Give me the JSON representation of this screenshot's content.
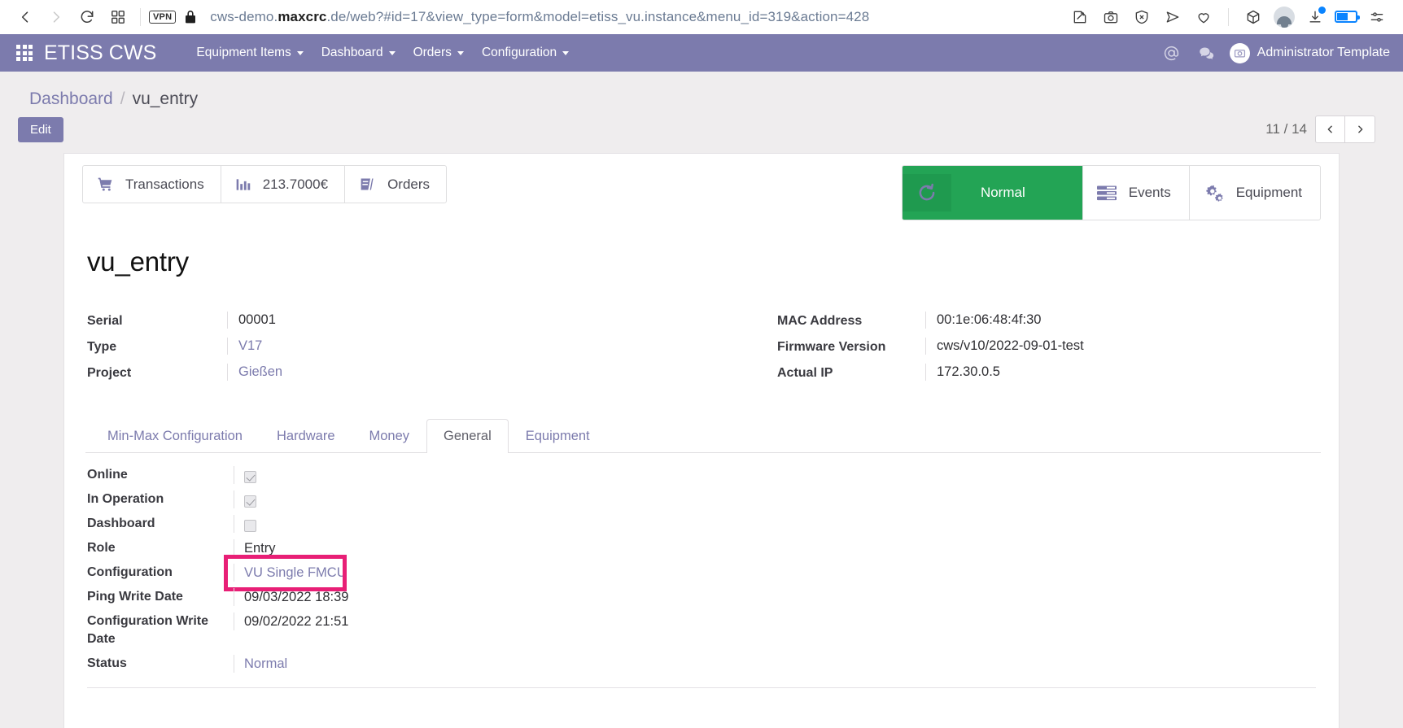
{
  "browser": {
    "back_icon": "back-arrow-icon",
    "forward_icon": "forward-arrow-icon",
    "reload_icon": "reload-icon",
    "tabs_icon": "tab-overview-icon",
    "vpn_label": "VPN",
    "lock_icon": "padlock-icon",
    "url_prefix": "cws-demo.",
    "url_domain": "maxcrc",
    "url_suffix": ".de/web?#id=17&view_type=form&model=etiss_vu.instance&menu_id=319&action=428",
    "right_icons": [
      "annotate-icon",
      "screenshot-icon",
      "shield-x-icon",
      "send-icon",
      "heart-icon",
      "extensions-cube-icon",
      "profile-avatar-icon",
      "downloads-icon",
      "battery-icon",
      "settings-sliders-icon"
    ]
  },
  "appnav": {
    "apps_icon": "apps-grid-icon",
    "brand": "ETISS CWS",
    "menus": [
      {
        "label": "Equipment Items",
        "caret": true
      },
      {
        "label": "Dashboard",
        "caret": true
      },
      {
        "label": "Orders",
        "caret": true
      },
      {
        "label": "Configuration",
        "caret": true
      }
    ],
    "mention_icon": "at-mention-icon",
    "chat_icon": "chat-bubble-icon",
    "user_name": "Administrator Template",
    "user_avatar_icon": "user-avatar-icon",
    "bar_color": "#7c7bad"
  },
  "breadcrumb": {
    "root": "Dashboard",
    "separator": "/",
    "current": "vu_entry"
  },
  "actions": {
    "edit_label": "Edit",
    "pager_label": "11 / 14",
    "prev_icon": "chevron-left-icon",
    "next_icon": "chevron-right-icon"
  },
  "stat_buttons": [
    {
      "label": "Transactions",
      "icon": "shopping-cart-icon"
    },
    {
      "label": "213.7000€",
      "icon": "bar-chart-icon"
    },
    {
      "label": "Orders",
      "icon": "book-orders-icon"
    }
  ],
  "status_buttons": [
    {
      "label": "Normal",
      "icon": "refresh-circle-icon",
      "state": "green",
      "color": "#23a455"
    },
    {
      "label": "Events",
      "icon": "list-lines-icon"
    },
    {
      "label": "Equipment",
      "icon": "gears-icon"
    }
  ],
  "record": {
    "title": "vu_entry",
    "left_fields": [
      {
        "label": "Serial",
        "value": "00001",
        "link": false
      },
      {
        "label": "Type",
        "value": "V17",
        "link": true
      },
      {
        "label": "Project",
        "value": "Gießen",
        "link": true
      }
    ],
    "right_fields": [
      {
        "label": "MAC Address",
        "value": "00:1e:06:48:4f:30",
        "link": false
      },
      {
        "label": "Firmware Version",
        "value": "cws/v10/2022-09-01-test",
        "link": false
      },
      {
        "label": "Actual IP",
        "value": "172.30.0.5",
        "link": false
      }
    ]
  },
  "tabs": [
    {
      "label": "Min-Max Configuration",
      "active": false
    },
    {
      "label": "Hardware",
      "active": false
    },
    {
      "label": "Money",
      "active": false
    },
    {
      "label": "General",
      "active": true
    },
    {
      "label": "Equipment",
      "active": false
    }
  ],
  "general_tab": {
    "rows": [
      {
        "label": "Online",
        "type": "checkbox",
        "checked": true,
        "value": ""
      },
      {
        "label": "In Operation",
        "type": "checkbox",
        "checked": true,
        "value": ""
      },
      {
        "label": "Dashboard",
        "type": "checkbox",
        "checked": false,
        "value": ""
      },
      {
        "label": "Role",
        "type": "text",
        "value": "Entry",
        "link": false
      },
      {
        "label": "Configuration",
        "type": "text",
        "value": "VU Single FMCU",
        "link": true,
        "highlighted": true
      },
      {
        "label": "Ping Write Date",
        "type": "text",
        "value": "09/03/2022 18:39",
        "link": false
      },
      {
        "label": "Configuration Write Date",
        "type": "text",
        "value": "09/02/2022 21:51",
        "link": false
      },
      {
        "label": "Status",
        "type": "text",
        "value": "Normal",
        "link": true
      }
    ],
    "highlight_color": "#e81f76"
  }
}
